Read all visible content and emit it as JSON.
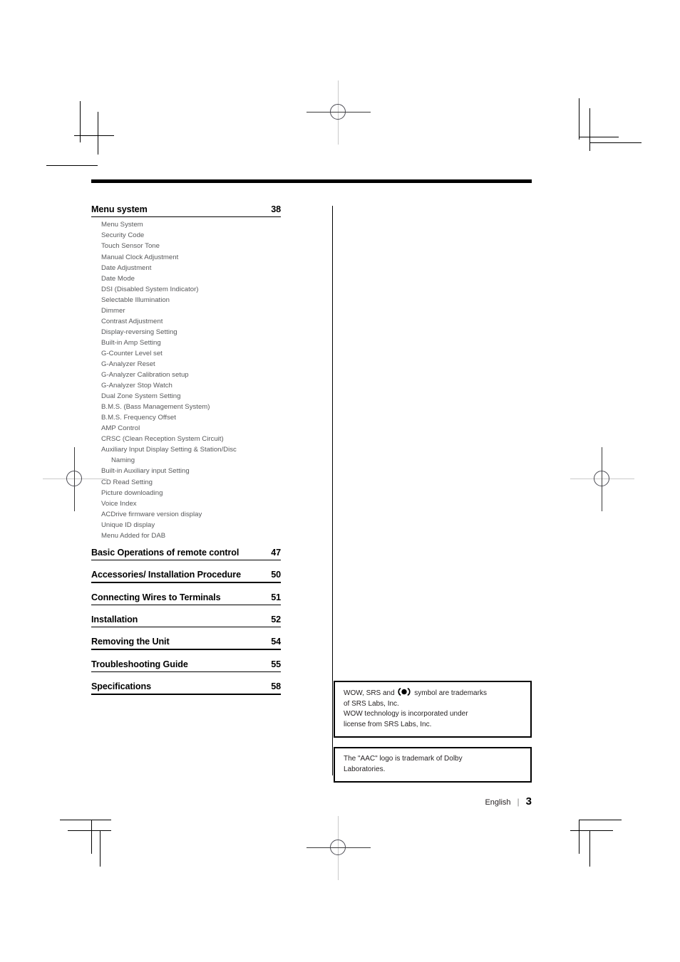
{
  "document": {
    "footer": {
      "language": "English",
      "separator": "|",
      "page_number": "3"
    }
  },
  "toc": {
    "entries": [
      {
        "title": "Menu system",
        "page": "38",
        "subitems": [
          "Menu System",
          "Security Code",
          "Touch Sensor Tone",
          "Manual Clock Adjustment",
          "Date Adjustment",
          "Date Mode",
          "DSI (Disabled System Indicator)",
          "Selectable Illumination",
          "Dimmer",
          "Contrast Adjustment",
          "Display-reversing Setting",
          "Built-in Amp Setting",
          "G-Counter Level set",
          "G-Analyzer Reset",
          "G-Analyzer Calibration setup",
          "G-Analyzer Stop Watch",
          "Dual Zone System Setting",
          "B.M.S. (Bass Management System)",
          "B.M.S. Frequency Offset",
          "AMP Control",
          "CRSC (Clean Reception System Circuit)",
          "Auxiliary Input Display Setting & Station/Disc",
          "Built-in Auxiliary input Setting",
          "CD Read Setting",
          "Picture downloading",
          "Voice Index",
          "ACDrive firmware version display",
          "Unique ID display",
          "Menu Added for DAB"
        ],
        "wrap_line": "Naming"
      },
      {
        "title": "Basic Operations of remote control",
        "page": "47"
      },
      {
        "title": "Accessories/ Installation Procedure",
        "page": "50"
      },
      {
        "title": "Connecting Wires to Terminals",
        "page": "51"
      },
      {
        "title": "Installation",
        "page": "52"
      },
      {
        "title": "Removing the Unit",
        "page": "54"
      },
      {
        "title": "Troubleshooting Guide",
        "page": "55"
      },
      {
        "title": "Specifications",
        "page": "58"
      }
    ]
  },
  "trademarks": {
    "srs": {
      "line1_before": "WOW, SRS and",
      "symbol_name": "srs-circle-symbol",
      "line1_after": "symbol are trademarks",
      "line2": "of SRS Labs, Inc.",
      "line3": "WOW technology is incorporated under",
      "line4": "license from SRS Labs, Inc."
    },
    "aac": {
      "line1": "The \"AAC\" logo is trademark of Dolby",
      "line2": "Laboratories."
    }
  },
  "colors": {
    "text": "#231f20",
    "subitem_text": "#58595b",
    "rule": "#000000"
  }
}
